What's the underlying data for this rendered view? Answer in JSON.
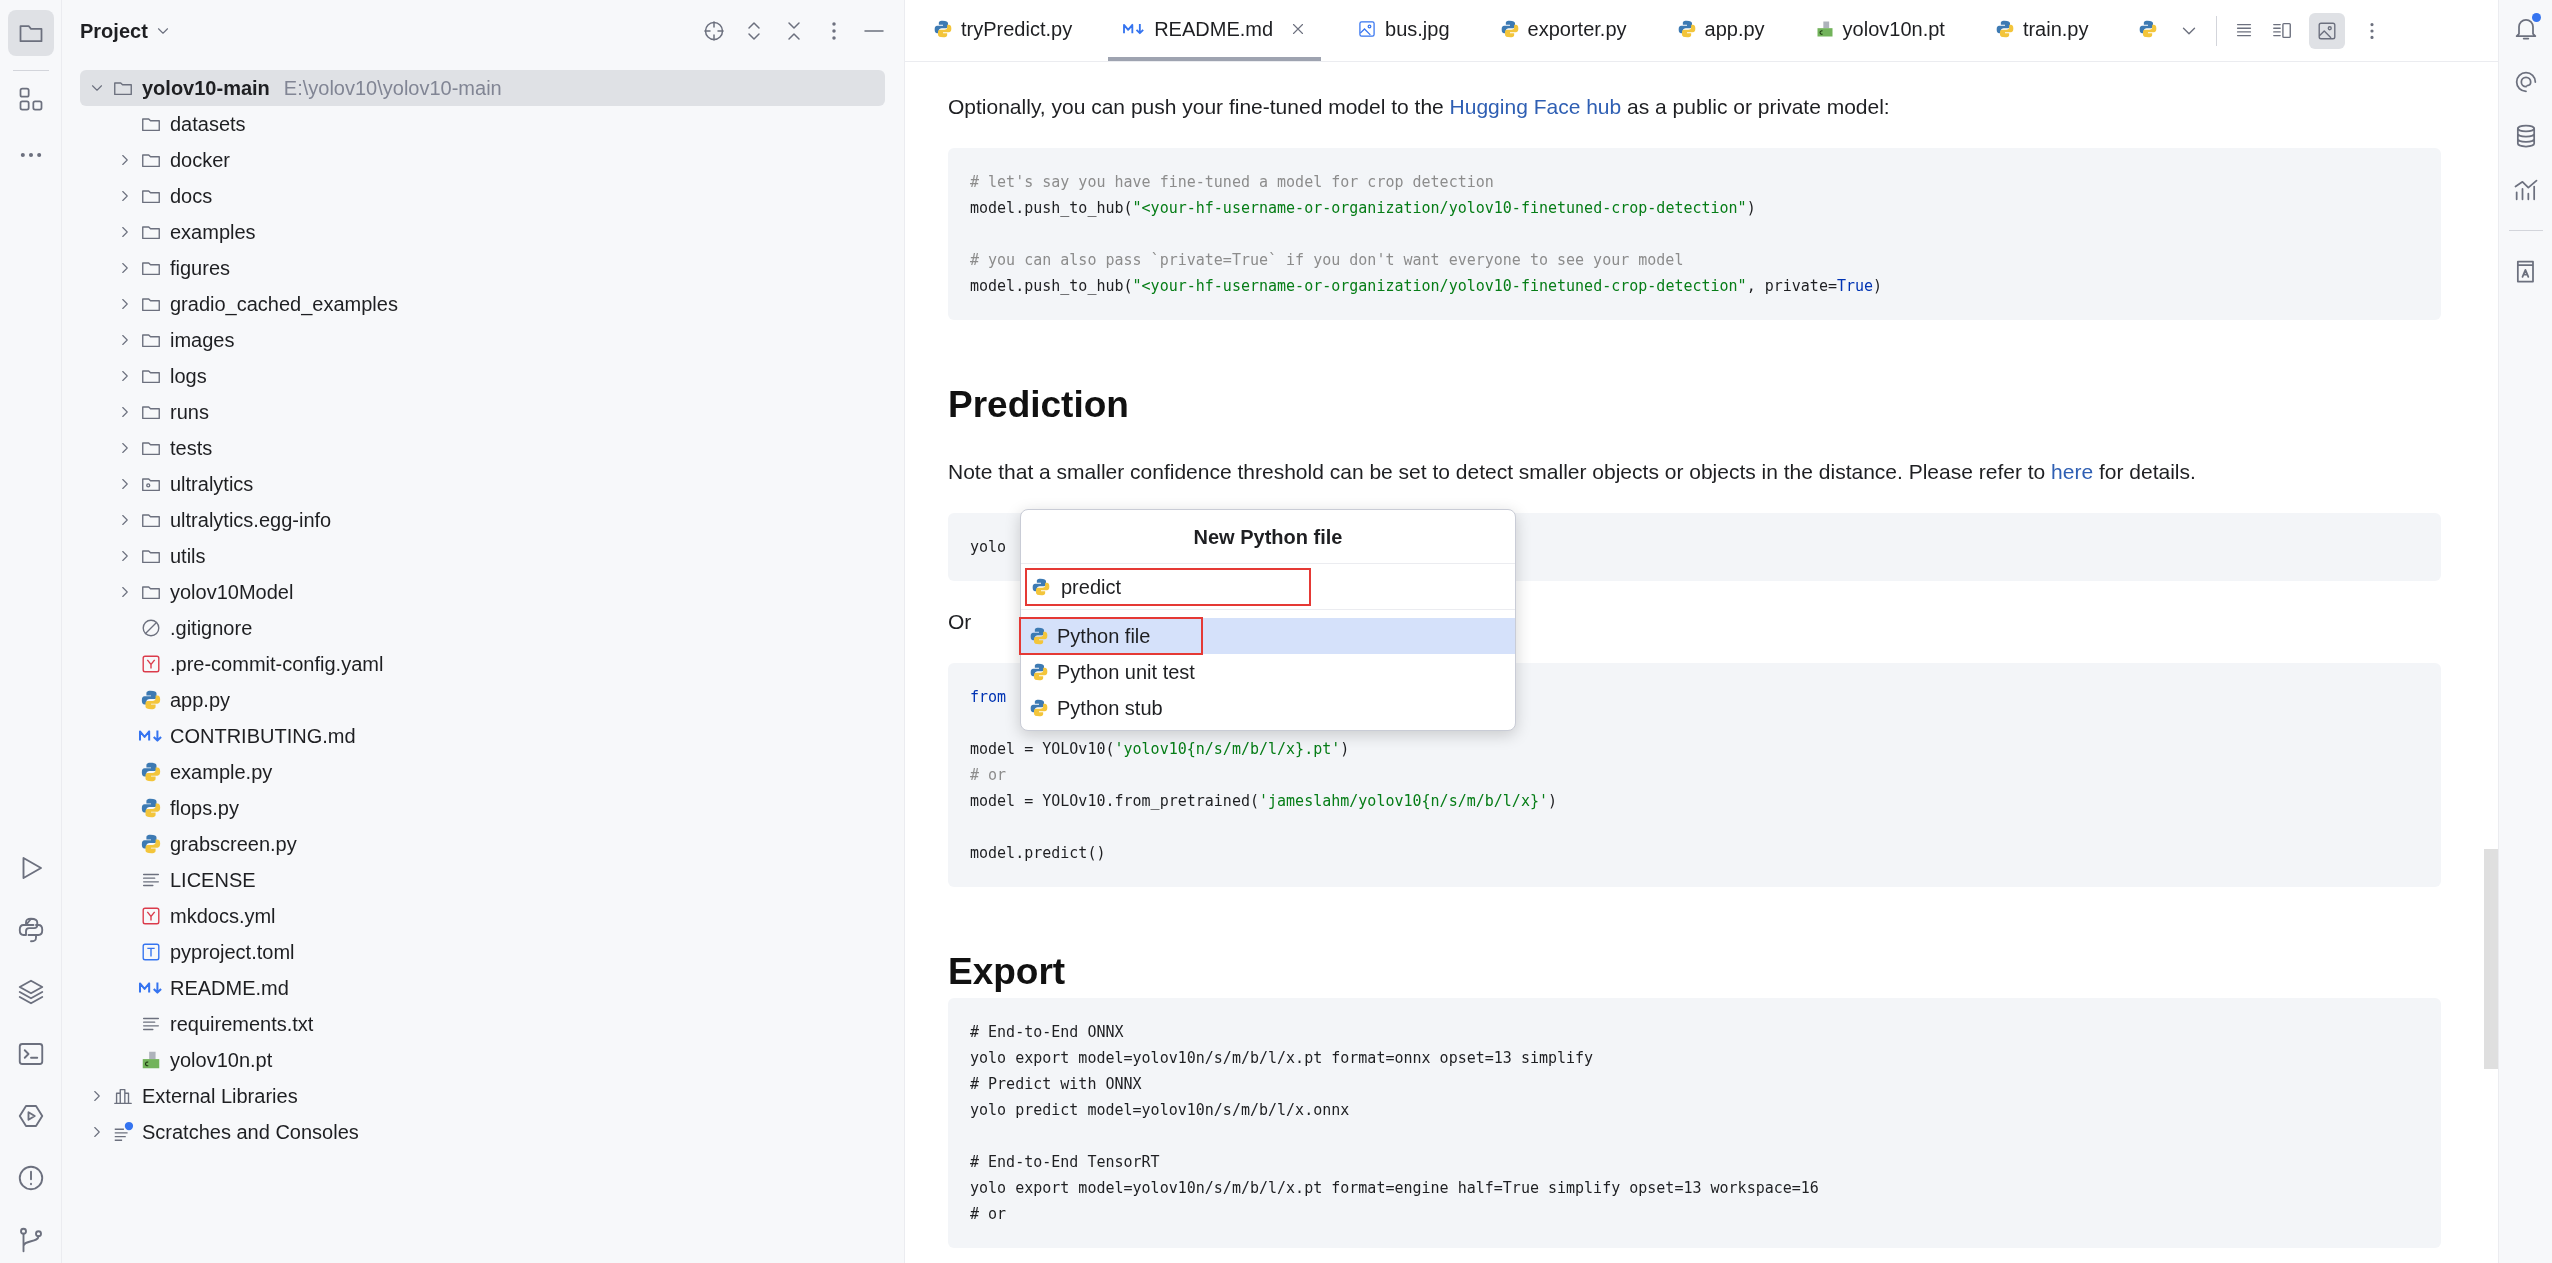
{
  "project_panel": {
    "title": "Project"
  },
  "tree": [
    {
      "label": "yolov10-main",
      "hint": "E:\\yolov10\\yolov10-main",
      "kind": "folder",
      "expanded": true,
      "selected": true,
      "children": [
        {
          "label": "datasets",
          "kind": "folder"
        },
        {
          "label": "docker",
          "kind": "folder",
          "expanded": false
        },
        {
          "label": "docs",
          "kind": "folder",
          "expanded": false
        },
        {
          "label": "examples",
          "kind": "folder",
          "expanded": false
        },
        {
          "label": "figures",
          "kind": "folder",
          "expanded": false
        },
        {
          "label": "gradio_cached_examples",
          "kind": "folder",
          "expanded": false
        },
        {
          "label": "images",
          "kind": "folder",
          "expanded": false
        },
        {
          "label": "logs",
          "kind": "folder",
          "expanded": false
        },
        {
          "label": "runs",
          "kind": "folder",
          "expanded": false
        },
        {
          "label": "tests",
          "kind": "folder",
          "expanded": false
        },
        {
          "label": "ultralytics",
          "kind": "package",
          "expanded": false
        },
        {
          "label": "ultralytics.egg-info",
          "kind": "folder",
          "expanded": false
        },
        {
          "label": "utils",
          "kind": "folder",
          "expanded": false
        },
        {
          "label": "yolov10Model",
          "kind": "folder",
          "expanded": false
        },
        {
          "label": ".gitignore",
          "kind": "ignore"
        },
        {
          "label": ".pre-commit-config.yaml",
          "kind": "yaml"
        },
        {
          "label": "app.py",
          "kind": "python"
        },
        {
          "label": "CONTRIBUTING.md",
          "kind": "markdown"
        },
        {
          "label": "example.py",
          "kind": "python"
        },
        {
          "label": "flops.py",
          "kind": "python"
        },
        {
          "label": "grabscreen.py",
          "kind": "python"
        },
        {
          "label": "LICENSE",
          "kind": "text"
        },
        {
          "label": "mkdocs.yml",
          "kind": "yaml"
        },
        {
          "label": "pyproject.toml",
          "kind": "toml"
        },
        {
          "label": "README.md",
          "kind": "markdown"
        },
        {
          "label": "requirements.txt",
          "kind": "text"
        },
        {
          "label": "yolov10n.pt",
          "kind": "model"
        }
      ]
    },
    {
      "label": "External Libraries",
      "kind": "library",
      "expanded": false
    },
    {
      "label": "Scratches and Consoles",
      "kind": "scratch",
      "expanded": false
    }
  ],
  "tabs": [
    {
      "label": "tryPredict.py",
      "kind": "python",
      "selected": false
    },
    {
      "label": "README.md",
      "kind": "markdown",
      "selected": true
    },
    {
      "label": "bus.jpg",
      "kind": "image",
      "selected": false
    },
    {
      "label": "exporter.py",
      "kind": "python",
      "selected": false
    },
    {
      "label": "app.py",
      "kind": "python",
      "selected": false
    },
    {
      "label": "yolov10n.pt",
      "kind": "model",
      "selected": false
    },
    {
      "label": "train.py",
      "kind": "python",
      "selected": false
    },
    {
      "kind": "python",
      "selected": false
    }
  ],
  "document": [
    {
      "kind": "paragraph",
      "segments": [
        {
          "text": "Optionally, you can push your fine-tuned model to the ",
          "kind": "plain"
        },
        {
          "text": "Hugging Face hub",
          "kind": "link"
        },
        {
          "text": " as a public or private model:",
          "kind": "plain"
        }
      ]
    },
    {
      "kind": "code",
      "lines": [
        {
          "segments": [
            {
              "text": "# let's say you have fine-tuned a model for crop detection",
              "kind": "comment"
            }
          ]
        },
        {
          "segments": [
            {
              "text": "model.push_to_hub(",
              "kind": "plain"
            },
            {
              "text": "\"<your-hf-username-or-organization/yolov10-finetuned-crop-detection\"",
              "kind": "string"
            },
            {
              "text": ")",
              "kind": "plain"
            }
          ]
        },
        {
          "gap_before": true,
          "segments": [
            {
              "text": "# you can also pass `private=True` if you don't want everyone to see your model",
              "kind": "comment"
            }
          ]
        },
        {
          "segments": [
            {
              "text": "model.push_to_hub(",
              "kind": "plain"
            },
            {
              "text": "\"<your-hf-username-or-organization/yolov10-finetuned-crop-detection\"",
              "kind": "string"
            },
            {
              "text": ", private=",
              "kind": "plain"
            },
            {
              "text": "True",
              "kind": "keyword"
            },
            {
              "text": ")",
              "kind": "plain"
            }
          ]
        }
      ]
    },
    {
      "kind": "heading",
      "text": "Prediction"
    },
    {
      "kind": "paragraph",
      "segments": [
        {
          "text": "Note that a smaller confidence threshold can be set to detect smaller objects or objects in the distance. Please refer to ",
          "kind": "plain"
        },
        {
          "text": "here",
          "kind": "link"
        },
        {
          "text": " for details.",
          "kind": "plain"
        }
      ]
    },
    {
      "kind": "code",
      "lines": [
        {
          "segments": [
            {
              "text": "yolo",
              "kind": "plain"
            }
          ]
        }
      ]
    },
    {
      "kind": "paragraph",
      "segments": [
        {
          "text": "Or",
          "kind": "plain"
        }
      ]
    },
    {
      "kind": "code",
      "lines": [
        {
          "segments": [
            {
              "text": "from",
              "kind": "keyword"
            }
          ]
        },
        {
          "gap_before": true,
          "segments": [
            {
              "text": "model = YOLOv10(",
              "kind": "plain"
            },
            {
              "text": "'yolov10{n/s/m/b/l/x}.pt'",
              "kind": "string"
            },
            {
              "text": ")",
              "kind": "plain"
            }
          ]
        },
        {
          "segments": [
            {
              "text": "# or",
              "kind": "comment"
            }
          ]
        },
        {
          "segments": [
            {
              "text": "model = YOLOv10.from_pretrained(",
              "kind": "plain"
            },
            {
              "text": "'jameslahm/yolov10{n/s/m/b/l/x}'",
              "kind": "string"
            },
            {
              "text": ")",
              "kind": "plain"
            }
          ]
        },
        {
          "gap_before": true,
          "segments": [
            {
              "text": "model.predict()",
              "kind": "plain"
            }
          ]
        }
      ]
    },
    {
      "kind": "heading",
      "text": "Export"
    },
    {
      "kind": "code",
      "lines": [
        {
          "segments": [
            {
              "text": "# End-to-End ONNX",
              "kind": "plain"
            }
          ]
        },
        {
          "segments": [
            {
              "text": "yolo export model=yolov10n/s/m/b/l/x.pt format=onnx opset=13 simplify",
              "kind": "plain"
            }
          ]
        },
        {
          "segments": [
            {
              "text": "# Predict with ONNX",
              "kind": "plain"
            }
          ]
        },
        {
          "segments": [
            {
              "text": "yolo predict model=yolov10n/s/m/b/l/x.onnx",
              "kind": "plain"
            }
          ]
        },
        {
          "gap_before": true,
          "segments": [
            {
              "text": "# End-to-End TensorRT",
              "kind": "plain"
            }
          ]
        },
        {
          "segments": [
            {
              "text": "yolo export model=yolov10n/s/m/b/l/x.pt format=engine half=True simplify opset=13 workspace=16",
              "kind": "plain"
            }
          ]
        },
        {
          "segments": [
            {
              "text": "# or",
              "kind": "plain"
            }
          ]
        }
      ]
    }
  ],
  "popup": {
    "title": "New Python file",
    "input": {
      "value": "predict",
      "highlighted": true
    },
    "options": [
      {
        "label": "Python file",
        "selected": true,
        "highlighted": true
      },
      {
        "label": "Python unit test",
        "selected": false,
        "highlighted": false
      },
      {
        "label": "Python stub",
        "selected": false,
        "highlighted": false
      }
    ]
  }
}
